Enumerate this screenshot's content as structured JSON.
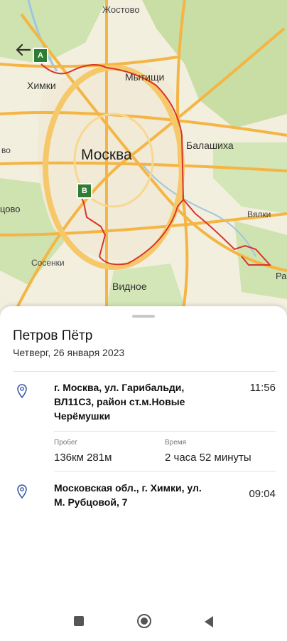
{
  "status_bar": {
    "time": "",
    "indicators": ""
  },
  "map": {
    "labels": {
      "zhostovo": "Жостово",
      "khimki": "Химки",
      "mytishchi": "Мытищи",
      "moskva": "Москва",
      "balashikha": "Балашиха",
      "vidnoe": "Видное",
      "sosenki": "Сосенки",
      "vyalki": "Вялки",
      "left_clip_1": "во",
      "left_clip_2": "цово",
      "right_clip": "Ра"
    },
    "marker_a": "A",
    "marker_b": "B",
    "route_color": "#d9342b"
  },
  "sheet": {
    "person_name": "Петров Пётр",
    "date": "Четверг, 26 января 2023",
    "end": {
      "address_line1": "г. Москва, ул. Гарибальди,",
      "address_line2": "ВЛ11С3, район ст.м.Новые",
      "address_line3": "Черёмушки",
      "time": "11:56"
    },
    "stats": {
      "distance_label": "Пробег",
      "distance_value": "136км 281м",
      "duration_label": "Время",
      "duration_value": "2 часа 52 минуты"
    },
    "start": {
      "address_line1": "Московская обл., г. Химки, ул.",
      "address_line2": "М. Рубцовой, 7",
      "time": "09:04"
    }
  },
  "icons": {
    "back": "arrow-left-icon",
    "pin": "location-pin-icon",
    "nav_square": "square-icon",
    "nav_circle": "circle-icon",
    "nav_back": "triangle-back-icon"
  }
}
